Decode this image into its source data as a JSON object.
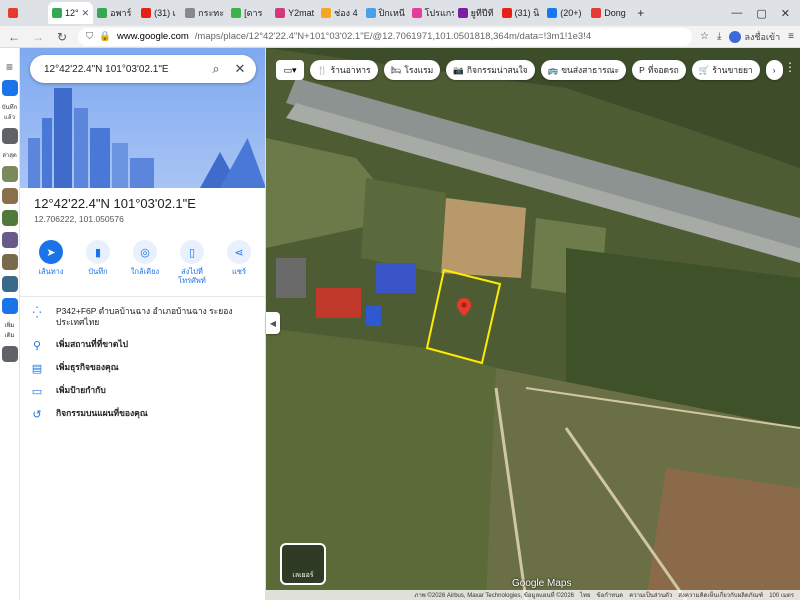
{
  "browser": {
    "tabs": [
      {
        "label": "",
        "color": "#e63b2e"
      },
      {
        "label": "12°",
        "color": "#34a853",
        "active": true
      },
      {
        "label": "อพาร์",
        "color": "#34a853"
      },
      {
        "label": "(31) เ",
        "color": "#e62117"
      },
      {
        "label": "กระทะ",
        "color": "#888888"
      },
      {
        "label": "[ดาร",
        "color": "#3bb34a"
      },
      {
        "label": "Y2mat",
        "color": "#d23a7a"
      },
      {
        "label": "ช่อง 4",
        "color": "#f5a623"
      },
      {
        "label": "ปิกเหนี",
        "color": "#4aa0e6"
      },
      {
        "label": "โปรแกร",
        "color": "#e43e9b"
      },
      {
        "label": "ยูทีปีที",
        "color": "#7a1fa2"
      },
      {
        "label": "(31) นิ",
        "color": "#e62117"
      },
      {
        "label": "(20+)",
        "color": "#1877f2"
      },
      {
        "label": "Dong",
        "color": "#e53935"
      }
    ],
    "new_tab": "+",
    "window_controls": [
      "—",
      "▢",
      "✕"
    ],
    "url_host": "www.google.com",
    "url_path": "/maps/place/12°42'22.4\"N+101°03'02.1\"E/@12.7061971,101.0501818,364m/data=!3m1!1e3!4",
    "signin": "ลงชื่อเข้า"
  },
  "rail": {
    "items": [
      {
        "label": "บันทึกแล้ว",
        "color": "#1a73e8"
      },
      {
        "label": "ล่าสุด",
        "color": "#5f6368"
      },
      {
        "label": "",
        "color": "#7b8a5a"
      },
      {
        "label": "",
        "color": "#8a6f4a"
      },
      {
        "label": "",
        "color": "#4f7a3a"
      },
      {
        "label": "",
        "color": "#6a5a8a"
      },
      {
        "label": "",
        "color": "#7a6a4a"
      },
      {
        "label": "",
        "color": "#3a6a8a"
      },
      {
        "label": "เพิ่มเติม",
        "color": "#1a73e8"
      },
      {
        "label": "",
        "color": "#5f6368"
      }
    ]
  },
  "panel": {
    "search_value": "12°42'22.4\"N 101°03'02.1\"E",
    "title": "12°42'22.4\"N 101°03'02.1\"E",
    "subtitle": "12.706222, 101.050576",
    "actions": [
      {
        "label": "เส้นทาง",
        "icon": "directions-icon",
        "glyph": "➤"
      },
      {
        "label": "บันทึก",
        "icon": "bookmark-icon",
        "glyph": "▮"
      },
      {
        "label": "ใกล้เคียง",
        "icon": "nearby-icon",
        "glyph": "◎"
      },
      {
        "label": "ส่งไปที่โทรศัพท์",
        "icon": "phone-icon",
        "glyph": "▯"
      },
      {
        "label": "แชร์",
        "icon": "share-icon",
        "glyph": "⋖"
      }
    ],
    "info": [
      {
        "icon": "pluscode-icon",
        "glyph": "⁛",
        "text": "P342+F6P ตำบลบ้านฉาง อำเภอบ้านฉาง ระยอง ประเทศไทย",
        "strong": false
      },
      {
        "icon": "add-place-icon",
        "glyph": "⚲",
        "text": "เพิ่มสถานที่ที่ขาดไป",
        "strong": true
      },
      {
        "icon": "business-icon",
        "glyph": "▤",
        "text": "เพิ่มธุรกิจของคุณ",
        "strong": true
      },
      {
        "icon": "label-icon",
        "glyph": "▭",
        "text": "เพิ่มป้ายกำกับ",
        "strong": true
      },
      {
        "icon": "history-icon",
        "glyph": "↺",
        "text": "กิจกรรมบนแผนที่ของคุณ",
        "strong": true
      }
    ]
  },
  "map": {
    "chips": [
      {
        "glyph": "🍴",
        "label": "ร้านอาหาร"
      },
      {
        "glyph": "🛏",
        "label": "โรงแรม"
      },
      {
        "glyph": "📷",
        "label": "กิจกรรมน่าสนใจ"
      },
      {
        "glyph": "🚌",
        "label": "ขนส่งสาธารณะ"
      },
      {
        "glyph": "P",
        "label": "ที่จอดรถ"
      },
      {
        "glyph": "🛒",
        "label": "ร้านขายยา"
      }
    ],
    "layers_label": "เลเยอร์",
    "google_label": "Google Maps",
    "footer": [
      "ภาพ ©2026 Airbus, Maxar Technologies, ข้อมูลแผนที่ ©2026",
      "ไทย",
      "ข้อกำหนด",
      "ความเป็นส่วนตัว",
      "ส่งความคิดเห็นเกี่ยวกับผลิตภัณฑ์",
      "100 เมตร"
    ]
  }
}
